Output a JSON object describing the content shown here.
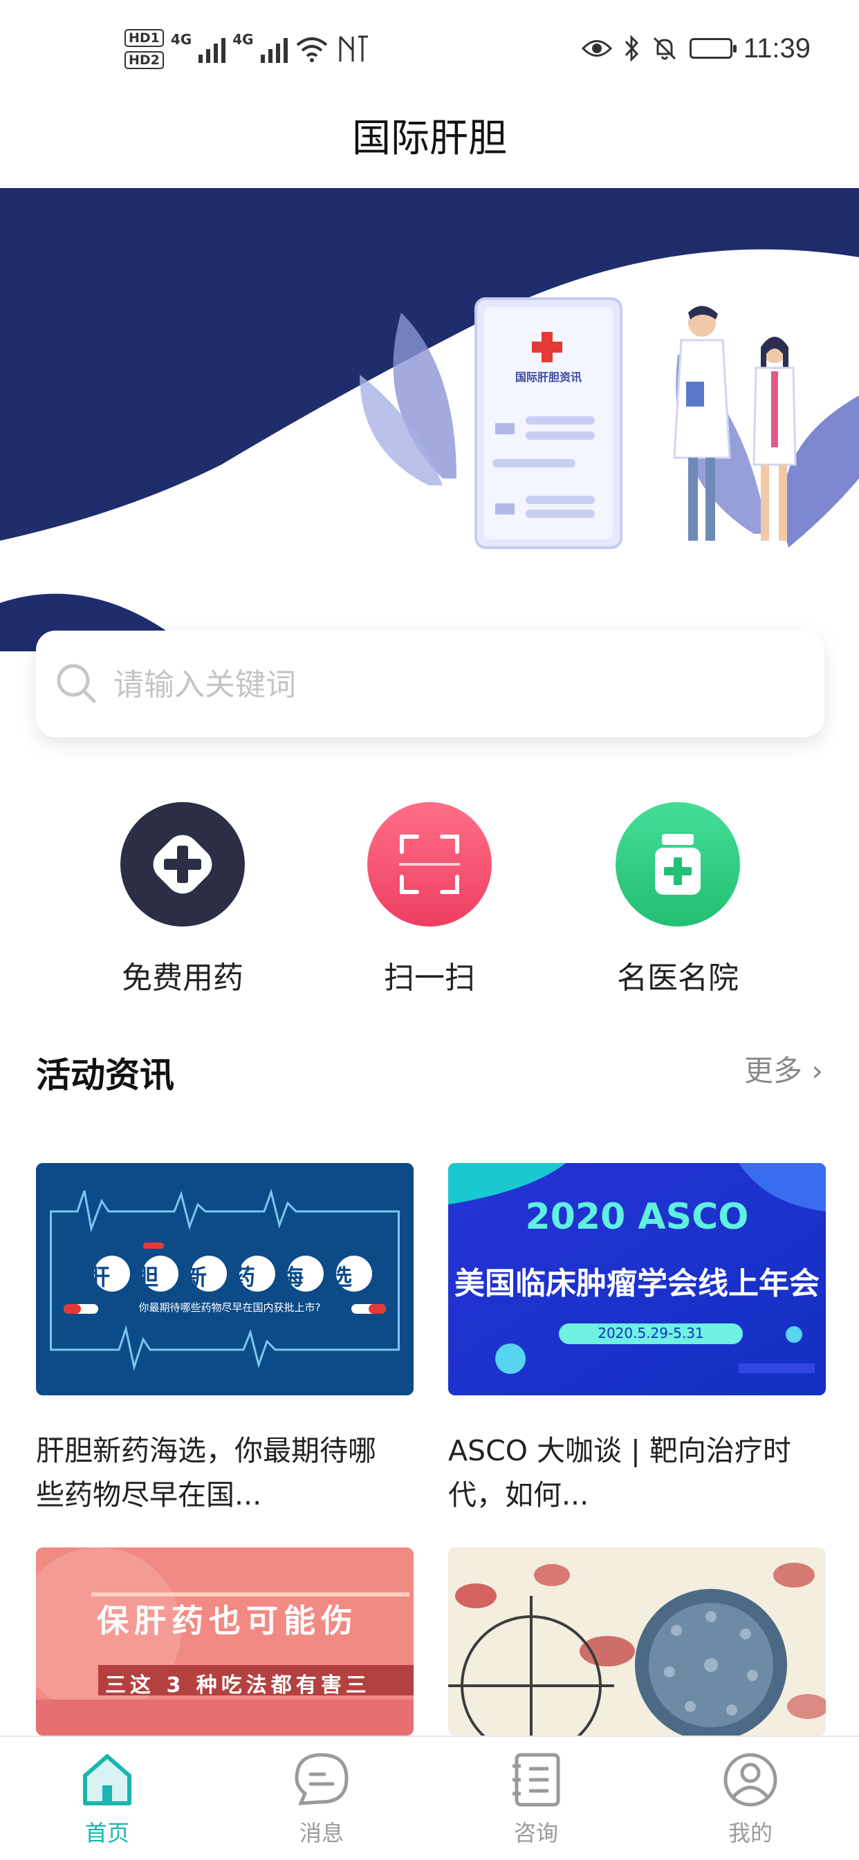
{
  "status_bar": {
    "hd1": "HD1",
    "hd2": "HD2",
    "net1": "4G",
    "net2": "4G",
    "time": "11:39"
  },
  "header": {
    "title": "国际肝胆"
  },
  "banner": {
    "card_title": "国际肝胆资讯",
    "slide_index": 1,
    "slide_count": 3
  },
  "search": {
    "placeholder": "请输入关键词",
    "value": ""
  },
  "quick_actions": [
    {
      "label": "免费用药",
      "icon": "plus-diamond-icon",
      "color": "#2b2e45"
    },
    {
      "label": "扫一扫",
      "icon": "scan-icon",
      "color": "#f24d6c"
    },
    {
      "label": "名医名院",
      "icon": "medicine-bottle-icon",
      "color": "#2fcf84"
    }
  ],
  "section": {
    "title": "活动资讯",
    "more_label": "更多",
    "more_icon": "chevron-right-icon"
  },
  "articles": [
    {
      "image_title": "肝胆新药海选",
      "image_subtitle": "你最期待哪些药物尽早在国内获批上市?",
      "title_line1": "肝胆新药海选，你最期待哪",
      "title_line2": "些药物尽早在国..."
    },
    {
      "image_title": "2020 ASCO",
      "image_subtitle": "美国临床肿瘤学会线上年会",
      "image_date": "2020.5.29-5.31",
      "title_line1": "ASCO 大咖谈 | 靶向治疗时",
      "title_line2": "代，如何..."
    },
    {
      "image_title": "保肝药也可能伤",
      "image_subtitle": "三这 3 种吃法都有害三"
    },
    {
      "image_description_icon": "virus-icon"
    }
  ],
  "tab_bar": {
    "tabs": [
      {
        "label": "首页",
        "icon": "home-icon",
        "active": true
      },
      {
        "label": "消息",
        "icon": "message-icon",
        "active": false
      },
      {
        "label": "咨询",
        "icon": "consult-icon",
        "active": false
      },
      {
        "label": "我的",
        "icon": "profile-icon",
        "active": false
      }
    ],
    "active_color": "#19b5b0",
    "inactive_color": "#9a9a9a"
  },
  "colors": {
    "banner_bg": "#1f2d6d",
    "accent": "#19b5b0"
  }
}
